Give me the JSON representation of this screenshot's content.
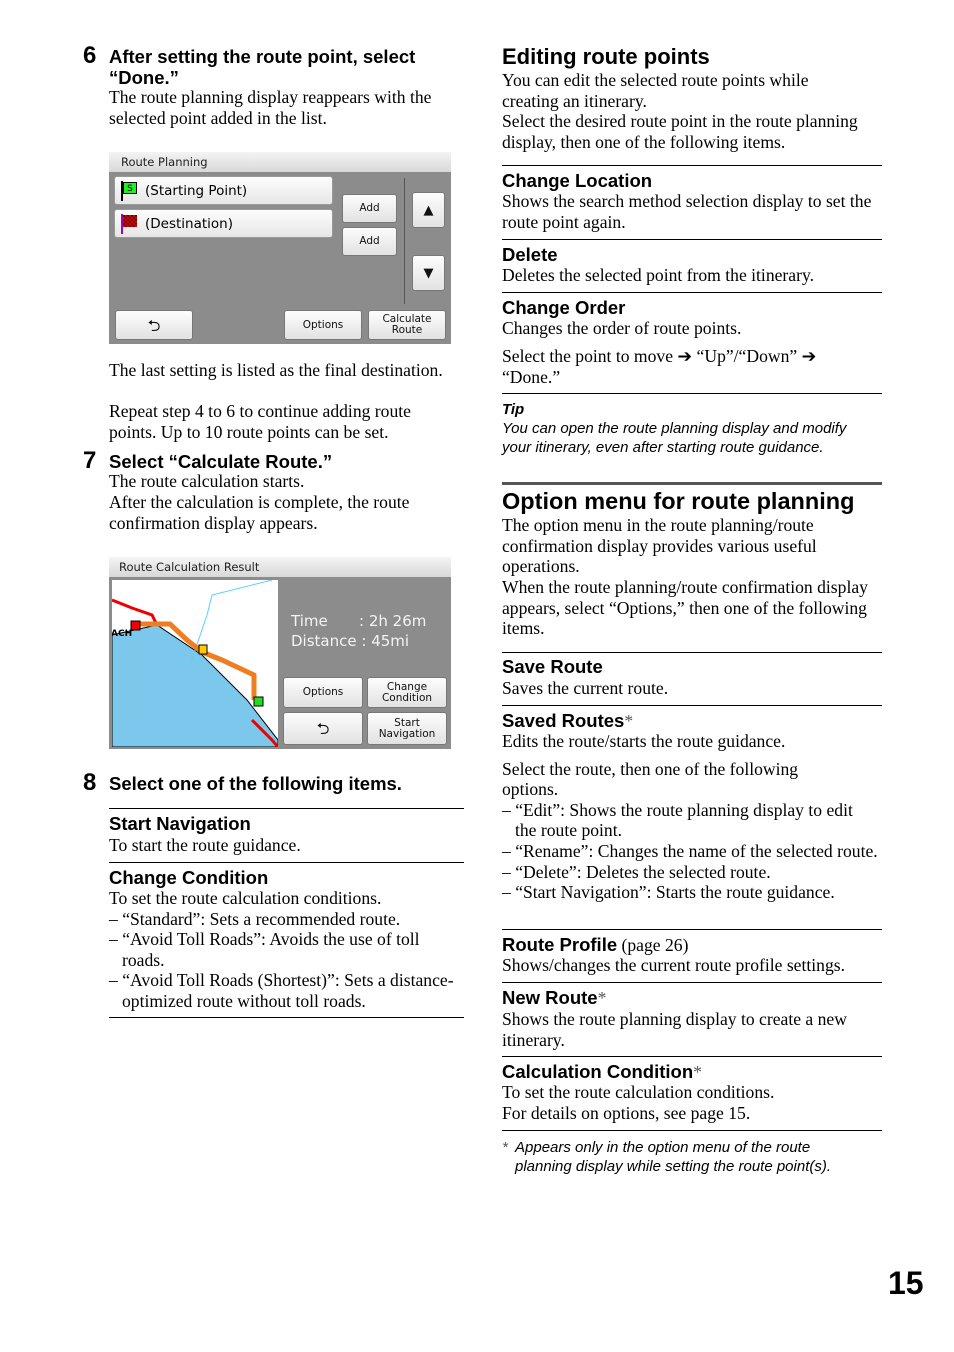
{
  "left": {
    "step6": {
      "num": "6",
      "heading": "After setting the route point, select “Done.”",
      "body": "The route planning display reappears with the selected point added in the list."
    },
    "screen1": {
      "title": "Route Planning",
      "start": "(Starting Point)",
      "dest": "(Destination)",
      "add1": "Add",
      "add2": "Add",
      "up": "▲",
      "down": "▼",
      "back": "⮌",
      "options": "Options",
      "calc": "Calculate Route",
      "start_flag": "S"
    },
    "after1": "The last setting is listed as the final destination.",
    "after2": "Repeat step 4 to 6 to continue adding route points. Up to 10 route points can be set.",
    "step7": {
      "num": "7",
      "heading": "Select “Calculate Route.”",
      "body1": "The route calculation starts.",
      "body2": "After the calculation is complete, the route confirmation display appears."
    },
    "screen2": {
      "title": "Route Calculation Result",
      "time_label": "Time",
      "time_sep": ":",
      "time_value": "2h 26m",
      "dist_label": "Distance",
      "dist_sep": ":",
      "dist_value": "45mi",
      "options": "Options",
      "change": "Change Condition",
      "back": "⮌",
      "start": "Start Navigation",
      "map_label": "ACH"
    },
    "step8": {
      "num": "8",
      "heading": "Select one of the following items."
    },
    "items": [
      {
        "title": "Start Navigation",
        "lines": [
          "To start the route guidance."
        ]
      },
      {
        "title": "Change Condition",
        "lines": [
          "To set the route calculation conditions."
        ],
        "dashes": [
          "– “Standard”: Sets a recommended route.",
          "– “Avoid Toll Roads”: Avoids the use of toll roads.",
          "– “Avoid Toll Roads (Shortest)”: Sets a distance-optimized route without toll roads."
        ]
      }
    ]
  },
  "right": {
    "editing": {
      "heading": "Editing route points",
      "p1": "You can edit the selected route points while creating an itinerary.",
      "p2": "Select the desired route point in the route planning display, then one of the following items."
    },
    "edit_items": [
      {
        "title": "Change Location",
        "body": "Shows the search method selection display to set the route point again."
      },
      {
        "title": "Delete",
        "body": "Deletes the selected point from the itinerary."
      },
      {
        "title": "Change Order",
        "body": "Changes the order of route points.",
        "body2": "Select the point to move ➔ “Up”/“Down” ➔ “Done.”"
      }
    ],
    "tip": {
      "label": "Tip",
      "text": "You can open the route planning display and modify your itinerary, even after starting route guidance."
    },
    "option": {
      "heading": "Option menu for route planning",
      "p1": "The option menu in the route planning/route confirmation display provides various useful operations.",
      "p2": "When the route planning/route confirmation display appears, select “Options,” then one of the following items."
    },
    "opt_items": [
      {
        "title": "Save Route",
        "body": "Saves the current route."
      },
      {
        "title": "Saved Routes",
        "mark": "*",
        "body": "Edits the route/starts the route guidance.",
        "body2": "Select the route, then one of the following options.",
        "dashes": [
          "– “Edit”: Shows the route planning display to edit the route point.",
          "– “Rename”: Changes the name of the selected route.",
          "– “Delete”: Deletes the selected route.",
          "– “Start Navigation”: Starts the route guidance."
        ]
      },
      {
        "title": "Route Profile",
        "ref": " (page 26)",
        "body": "Shows/changes the current route profile settings."
      },
      {
        "title": "New Route",
        "mark": "*",
        "body": "Shows the route planning display to create a new itinerary."
      },
      {
        "title": "Calculation Condition",
        "mark": "*",
        "body": "To set the route calculation conditions.",
        "body2": "For details on options, see page 15."
      }
    ],
    "footnote": {
      "mark": "*",
      "text": "Appears only in the option menu of the route planning display while setting the route point(s)."
    }
  },
  "page_number": "15"
}
